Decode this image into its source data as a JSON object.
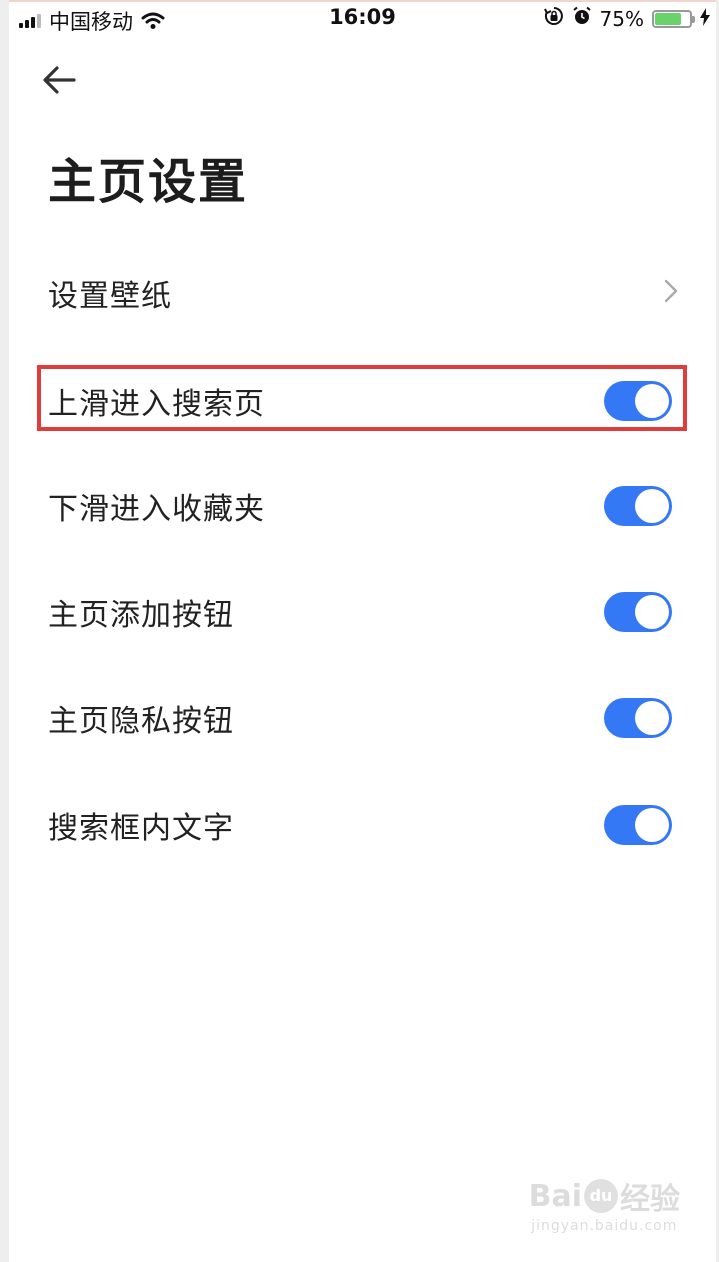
{
  "status_bar": {
    "carrier": "中国移动",
    "time": "16:09",
    "battery_percent": "75%",
    "battery_level": 0.75,
    "icons": [
      "signal-icon",
      "wifi-icon",
      "rotation-lock-icon",
      "alarm-icon",
      "battery-icon",
      "charging-icon"
    ]
  },
  "header": {
    "back_icon": "back-arrow-icon",
    "title": "主页设置"
  },
  "settings": {
    "items": [
      {
        "label": "设置壁纸",
        "control": "chevron"
      },
      {
        "label": "上滑进入搜索页",
        "control": "toggle",
        "on": true,
        "highlighted": true
      },
      {
        "label": "下滑进入收藏夹",
        "control": "toggle",
        "on": true
      },
      {
        "label": "主页添加按钮",
        "control": "toggle",
        "on": true
      },
      {
        "label": "主页隐私按钮",
        "control": "toggle",
        "on": true
      },
      {
        "label": "搜索框内文字",
        "control": "toggle",
        "on": true
      }
    ]
  },
  "colors": {
    "toggle_on": "#3478f6",
    "highlight_border": "#e03c3c",
    "battery_fill": "#6ad26a"
  },
  "watermark": {
    "logo": "Bai du 经验",
    "subtext": "jingyan.baidu.com"
  }
}
